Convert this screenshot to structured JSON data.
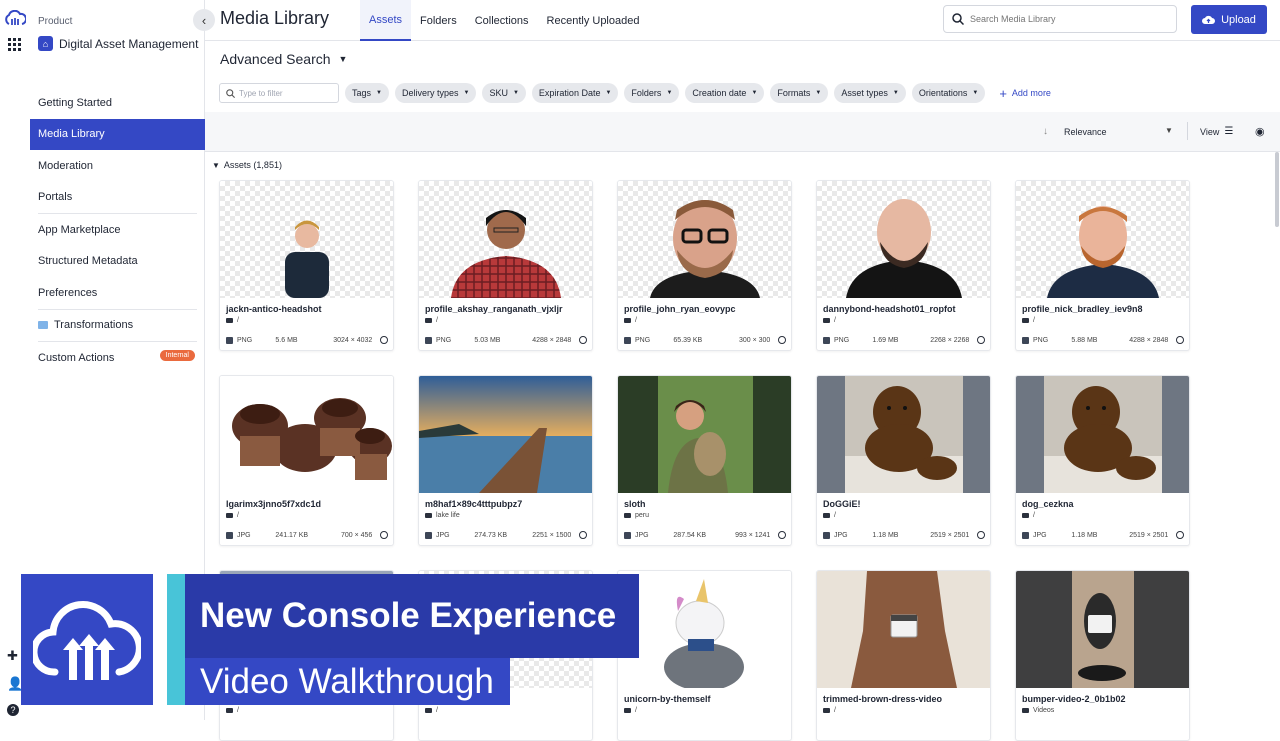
{
  "sidebar": {
    "product_label": "Product",
    "product_name": "Digital Asset Management",
    "items": [
      {
        "label": "Getting Started"
      },
      {
        "label": "Media Library"
      },
      {
        "label": "Moderation"
      },
      {
        "label": "Portals"
      },
      {
        "label": "App Marketplace"
      },
      {
        "label": "Structured Metadata"
      },
      {
        "label": "Preferences"
      },
      {
        "label": "Transformations"
      },
      {
        "label": "Custom Actions",
        "badge": "Internal"
      }
    ]
  },
  "header": {
    "title": "Media Library",
    "tabs": [
      "Assets",
      "Folders",
      "Collections",
      "Recently Uploaded"
    ],
    "search_placeholder": "Search Media Library",
    "upload_label": "Upload"
  },
  "filters": {
    "advanced_search": "Advanced Search",
    "filter_placeholder": "Type to filter",
    "chips": [
      "Tags",
      "Delivery types",
      "SKU",
      "Expiration Date",
      "Folders",
      "Creation date",
      "Formats",
      "Asset types",
      "Orientations"
    ],
    "add_more": "Add more"
  },
  "sort": {
    "label": "Relevance",
    "view_label": "View"
  },
  "assets_header": "Assets (1,851)",
  "assets": [
    {
      "name": "jackn-antico-headshot",
      "folder": "/",
      "format": "PNG",
      "size": "5.6 MB",
      "dims": "3024 × 4032"
    },
    {
      "name": "profile_akshay_ranganath_vjxljr",
      "folder": "/",
      "format": "PNG",
      "size": "5.03 MB",
      "dims": "4288 × 2848"
    },
    {
      "name": "profile_john_ryan_eovypc",
      "folder": "/",
      "format": "PNG",
      "size": "65.39 KB",
      "dims": "300 × 300"
    },
    {
      "name": "dannybond-headshot01_ropfot",
      "folder": "/",
      "format": "PNG",
      "size": "1.69 MB",
      "dims": "2268 × 2268"
    },
    {
      "name": "profile_nick_bradley_iev9n8",
      "folder": "/",
      "format": "PNG",
      "size": "5.88 MB",
      "dims": "4288 × 2848"
    },
    {
      "name": "lgarimx3jnno5f7xdc1d",
      "folder": "/",
      "format": "JPG",
      "size": "241.17 KB",
      "dims": "700 × 456"
    },
    {
      "name": "m8haf1×89c4tttpubpz7",
      "folder": "lake life",
      "format": "JPG",
      "size": "274.73 KB",
      "dims": "2251 × 1500"
    },
    {
      "name": "sloth",
      "folder": "peru",
      "format": "JPG",
      "size": "287.54 KB",
      "dims": "993 × 1241"
    },
    {
      "name": "DoGGiE!",
      "folder": "/",
      "format": "JPG",
      "size": "1.18 MB",
      "dims": "2519 × 2501"
    },
    {
      "name": "dog_cezkna",
      "folder": "/",
      "format": "JPG",
      "size": "1.18 MB",
      "dims": "2519 × 2501"
    },
    {
      "name": "",
      "folder": "/"
    },
    {
      "name": "",
      "folder": "/"
    },
    {
      "name": "unicorn-by-themself",
      "folder": "/"
    },
    {
      "name": "trimmed-brown-dress-video",
      "folder": "/"
    },
    {
      "name": "bumper-video-2_0b1b02",
      "folder": "Videos"
    }
  ],
  "banner": {
    "line1": "New Console Experience",
    "line2": "Video Walkthrough"
  },
  "colors": {
    "accent": "#3448c5",
    "banner_dark": "#2a3aa8",
    "banner_teal": "#48c4d8",
    "badge": "#ea6a3e"
  }
}
